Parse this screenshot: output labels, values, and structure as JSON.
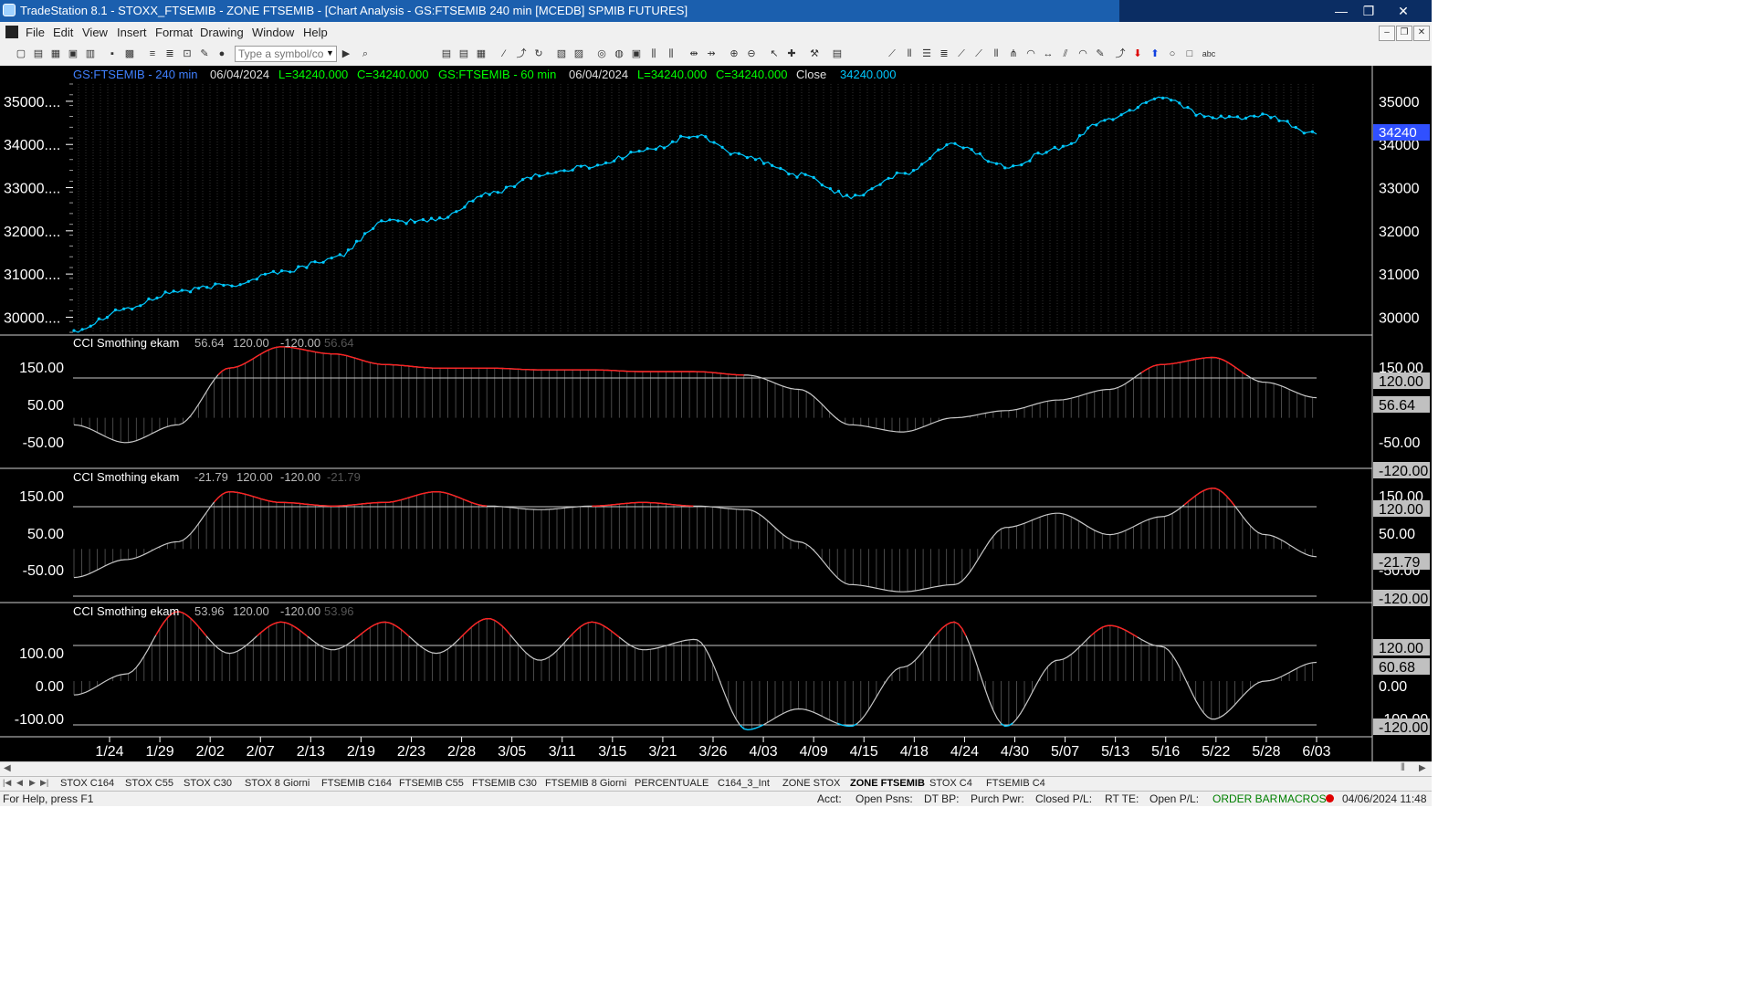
{
  "window": {
    "app": "TradeStation 8.1",
    "title": "TradeStation 8.1 - STOXX_FTSEMIB - ZONE FTSEMIB - [Chart Analysis - GS:FTSEMIB  240 min  [MCEDB] SPMIB FUTURES]",
    "minimize": "—",
    "maximize": "❐",
    "close": "✕"
  },
  "menu": {
    "items": [
      "File",
      "Edit",
      "View",
      "Insert",
      "Format",
      "Drawing",
      "Window",
      "Help"
    ],
    "mdi": [
      "–",
      "❐",
      "✕"
    ]
  },
  "toolbar": {
    "symbol_placeholder": "Type a symbol/co",
    "dropdown_icon": "▼",
    "go_icon": "▶"
  },
  "colors": {
    "background": "#000000",
    "price_line": "#00c8ff",
    "cci_line": "#c8c8c8",
    "cci_overbought": "#ff2020",
    "cci_oversold": "#00c8ff",
    "header_symbol": "#4080ff",
    "header_values": "#00ff00",
    "last_price_label": "#3050ff"
  },
  "price_panel": {
    "header": {
      "symbol1": "GS:FTSEMIB - 240 min",
      "date1": "06/04/2024",
      "low1": "L=34240.000",
      "close1": "C=34240.000",
      "symbol2": "GS:FTSEMIB - 60 min",
      "date2": "06/04/2024",
      "low2": "L=34240.000",
      "close2": "C=34240.000",
      "close_label": "Close",
      "close_value": "34240.000"
    },
    "left_axis": [
      "35000....",
      "34000....",
      "33000....",
      "32000....",
      "31000....",
      "30000...."
    ],
    "right_axis": [
      "35000",
      "34000",
      "33000",
      "32000",
      "31000",
      "30000"
    ],
    "last_price": "34240"
  },
  "cci_panels": [
    {
      "title": "CCI Smothing ekam",
      "value": "56.64",
      "upper": "120.00",
      "lower": "-120.00",
      "value_dim": "56.64",
      "left_axis": [
        "150.00",
        "50.00",
        "-50.00"
      ],
      "right_axis": [
        "150.00",
        "120.00",
        "56.64",
        "-50.00",
        "-120.00"
      ]
    },
    {
      "title": "CCI Smothing ekam",
      "value": "-21.79",
      "upper": "120.00",
      "lower": "-120.00",
      "value_dim": "-21.79",
      "left_axis": [
        "150.00",
        "50.00",
        "-50.00"
      ],
      "right_axis": [
        "150.00",
        "120.00",
        "50.00",
        "-50.00",
        "-21.79",
        "-120.00"
      ]
    },
    {
      "title": "CCI Smothing ekam",
      "value": "53.96",
      "upper": "120.00",
      "lower": "-120.00",
      "value_dim": "53.96",
      "left_axis": [
        "100.00",
        "0.00",
        "-100.00"
      ],
      "right_axis": [
        "120.00",
        "60.68",
        "0.00",
        "-100.00",
        "-120.00"
      ]
    }
  ],
  "x_axis": [
    "1/24",
    "1/29",
    "2/02",
    "2/07",
    "2/13",
    "2/19",
    "2/23",
    "2/28",
    "3/05",
    "3/11",
    "3/15",
    "3/21",
    "3/26",
    "4/03",
    "4/09",
    "4/15",
    "4/18",
    "4/24",
    "4/30",
    "5/07",
    "5/13",
    "5/16",
    "5/22",
    "5/28",
    "6/03"
  ],
  "chart_data": [
    {
      "type": "line",
      "name": "GS:FTSEMIB - 240 min",
      "x": [
        "1/24",
        "1/29",
        "2/02",
        "2/07",
        "2/13",
        "2/19",
        "2/23",
        "2/28",
        "3/05",
        "3/11",
        "3/15",
        "3/21",
        "3/26",
        "4/03",
        "4/09",
        "4/15",
        "4/18",
        "4/24",
        "4/30",
        "5/07",
        "5/13",
        "5/16",
        "5/22",
        "5/28",
        "6/03"
      ],
      "y": [
        29700,
        30200,
        30600,
        30750,
        31050,
        31350,
        32200,
        32250,
        32850,
        33300,
        33500,
        33850,
        34200,
        33700,
        33300,
        32800,
        33300,
        34000,
        33500,
        33900,
        34600,
        35100,
        34600,
        34650,
        34240
      ],
      "ylim": [
        29650,
        35400
      ],
      "right_ticks": [
        35000,
        34000,
        33000,
        32000,
        31000,
        30000
      ]
    },
    {
      "type": "line",
      "name": "CCI Smothing ekam",
      "x": [
        "1/24",
        "1/29",
        "2/02",
        "2/07",
        "2/13",
        "2/19",
        "2/23",
        "2/28",
        "3/05",
        "3/11",
        "3/15",
        "3/21",
        "3/26",
        "4/03",
        "4/09",
        "4/15",
        "4/18",
        "4/24",
        "4/30",
        "5/07",
        "5/13",
        "5/16",
        "5/22",
        "5/28",
        "6/03"
      ],
      "y": [
        -20,
        -70,
        -20,
        140,
        200,
        180,
        150,
        140,
        140,
        135,
        135,
        130,
        130,
        120,
        80,
        -20,
        -40,
        0,
        20,
        50,
        80,
        150,
        170,
        100,
        56.64
      ],
      "levels": [
        120,
        -120
      ],
      "ylim": [
        -140,
        215
      ]
    },
    {
      "type": "line",
      "name": "CCI Smothing ekam",
      "x": [
        "1/24",
        "1/29",
        "2/02",
        "2/07",
        "2/13",
        "2/19",
        "2/23",
        "2/28",
        "3/05",
        "3/11",
        "3/15",
        "3/21",
        "3/26",
        "4/03",
        "4/09",
        "4/15",
        "4/18",
        "4/24",
        "4/30",
        "5/07",
        "5/13",
        "5/16",
        "5/22",
        "5/28",
        "6/03"
      ],
      "y": [
        -80,
        -30,
        20,
        160,
        130,
        120,
        130,
        160,
        120,
        110,
        120,
        130,
        120,
        110,
        20,
        -100,
        -120,
        -100,
        60,
        100,
        40,
        90,
        170,
        40,
        -21.79
      ],
      "levels": [
        120,
        -120
      ],
      "ylim": [
        -145,
        205
      ]
    },
    {
      "type": "line",
      "name": "CCI Smothing ekam",
      "x": [
        "1/24",
        "1/29",
        "2/02",
        "2/07",
        "2/13",
        "2/19",
        "2/23",
        "2/28",
        "3/05",
        "3/11",
        "3/15",
        "3/21",
        "3/26",
        "4/03",
        "4/09",
        "4/15",
        "4/18",
        "4/24",
        "4/30",
        "5/07",
        "5/13",
        "5/16",
        "5/22",
        "5/28",
        "6/03"
      ],
      "y": [
        -40,
        20,
        200,
        80,
        170,
        90,
        170,
        80,
        180,
        60,
        170,
        90,
        120,
        -140,
        -80,
        -130,
        40,
        170,
        -130,
        60,
        160,
        100,
        -110,
        0,
        53.96
      ],
      "levels": [
        120,
        -120
      ],
      "ylim": [
        -155,
        205
      ]
    }
  ],
  "tabs": [
    "STOX C164",
    "STOX C55",
    "STOX  C30",
    "STOX  8 Giorni",
    "FTSEMIB C164",
    "FTSEMIB C55",
    "FTSEMIB C30",
    "FTSEMIB  8 Giorni",
    "PERCENTUALE",
    "C164_3_Int",
    "ZONE STOX",
    "ZONE FTSEMIB",
    "STOX  C4",
    "FTSEMIB C4"
  ],
  "tab_nav": [
    "|◀",
    "◀",
    "▶",
    "▶|"
  ],
  "active_tab": "ZONE FTSEMIB",
  "status": {
    "help": "For Help, press F1",
    "acct": "Acct:",
    "open_psns": "Open Psns:",
    "dt_bp": "DT BP:",
    "purch_pwr": "Purch Pwr:",
    "closed_pl": "Closed P/L:",
    "rt_te": "RT TE:",
    "open_pl": "Open P/L:",
    "order_bar": "ORDER BAR",
    "macros": "MACROS",
    "datetime": "04/06/2024 11:48"
  }
}
